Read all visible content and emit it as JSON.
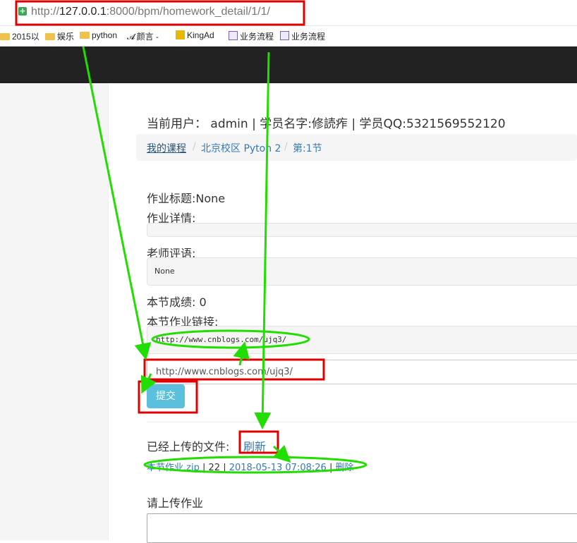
{
  "browser": {
    "url_scheme": "http://",
    "url_host": "127.0.0.1",
    "url_rest": ":8000/bpm/homework_detail/1/1/",
    "bookmarks": [
      {
        "label": "2015以",
        "icon": "folder-icon"
      },
      {
        "label": "娱乐",
        "icon": "folder-icon"
      },
      {
        "label": "python",
        "icon": "folder-icon"
      },
      {
        "label": "颜言 -",
        "icon": "site-icon"
      },
      {
        "label": "KingAd",
        "icon": "kingad-icon"
      },
      {
        "label": "业务流程",
        "icon": "page-icon"
      },
      {
        "label": "业务流程",
        "icon": "page-icon"
      }
    ]
  },
  "user_line": "当前用户： admin | 学员名字:修読痄 | 学员QQ:5321569552120",
  "breadcrumb": {
    "items": [
      "我的课程",
      "北京校区 Pyton 2",
      "第:1节"
    ],
    "separator": "/"
  },
  "homework": {
    "title_line": "作业标题:None",
    "detail_label": "作业详情:",
    "detail_value": "",
    "comment_label": "老师评语:",
    "comment_value": "None",
    "score_line": "本节成绩: 0",
    "link_label": "本节作业链接:",
    "link_value": "http://www.cnblogs.com/ujq3/",
    "link_input_value": "http://www.cnblogs.com/ujq3/",
    "submit_label": "提交"
  },
  "uploaded": {
    "label": "已经上传的文件:",
    "refresh_label": "刷新",
    "file_name": "本节作业.zip",
    "file_size": "22",
    "file_time": "2018-05-13 07:08:26",
    "delete_label": "删除",
    "sep": "|"
  },
  "upload_prompt": "请上传作业",
  "colors": {
    "annotation_red": "#e00000",
    "annotation_green": "#22dd00",
    "navbar": "#222222",
    "submit_button": "#5bc0de",
    "link": "#337ab7"
  }
}
